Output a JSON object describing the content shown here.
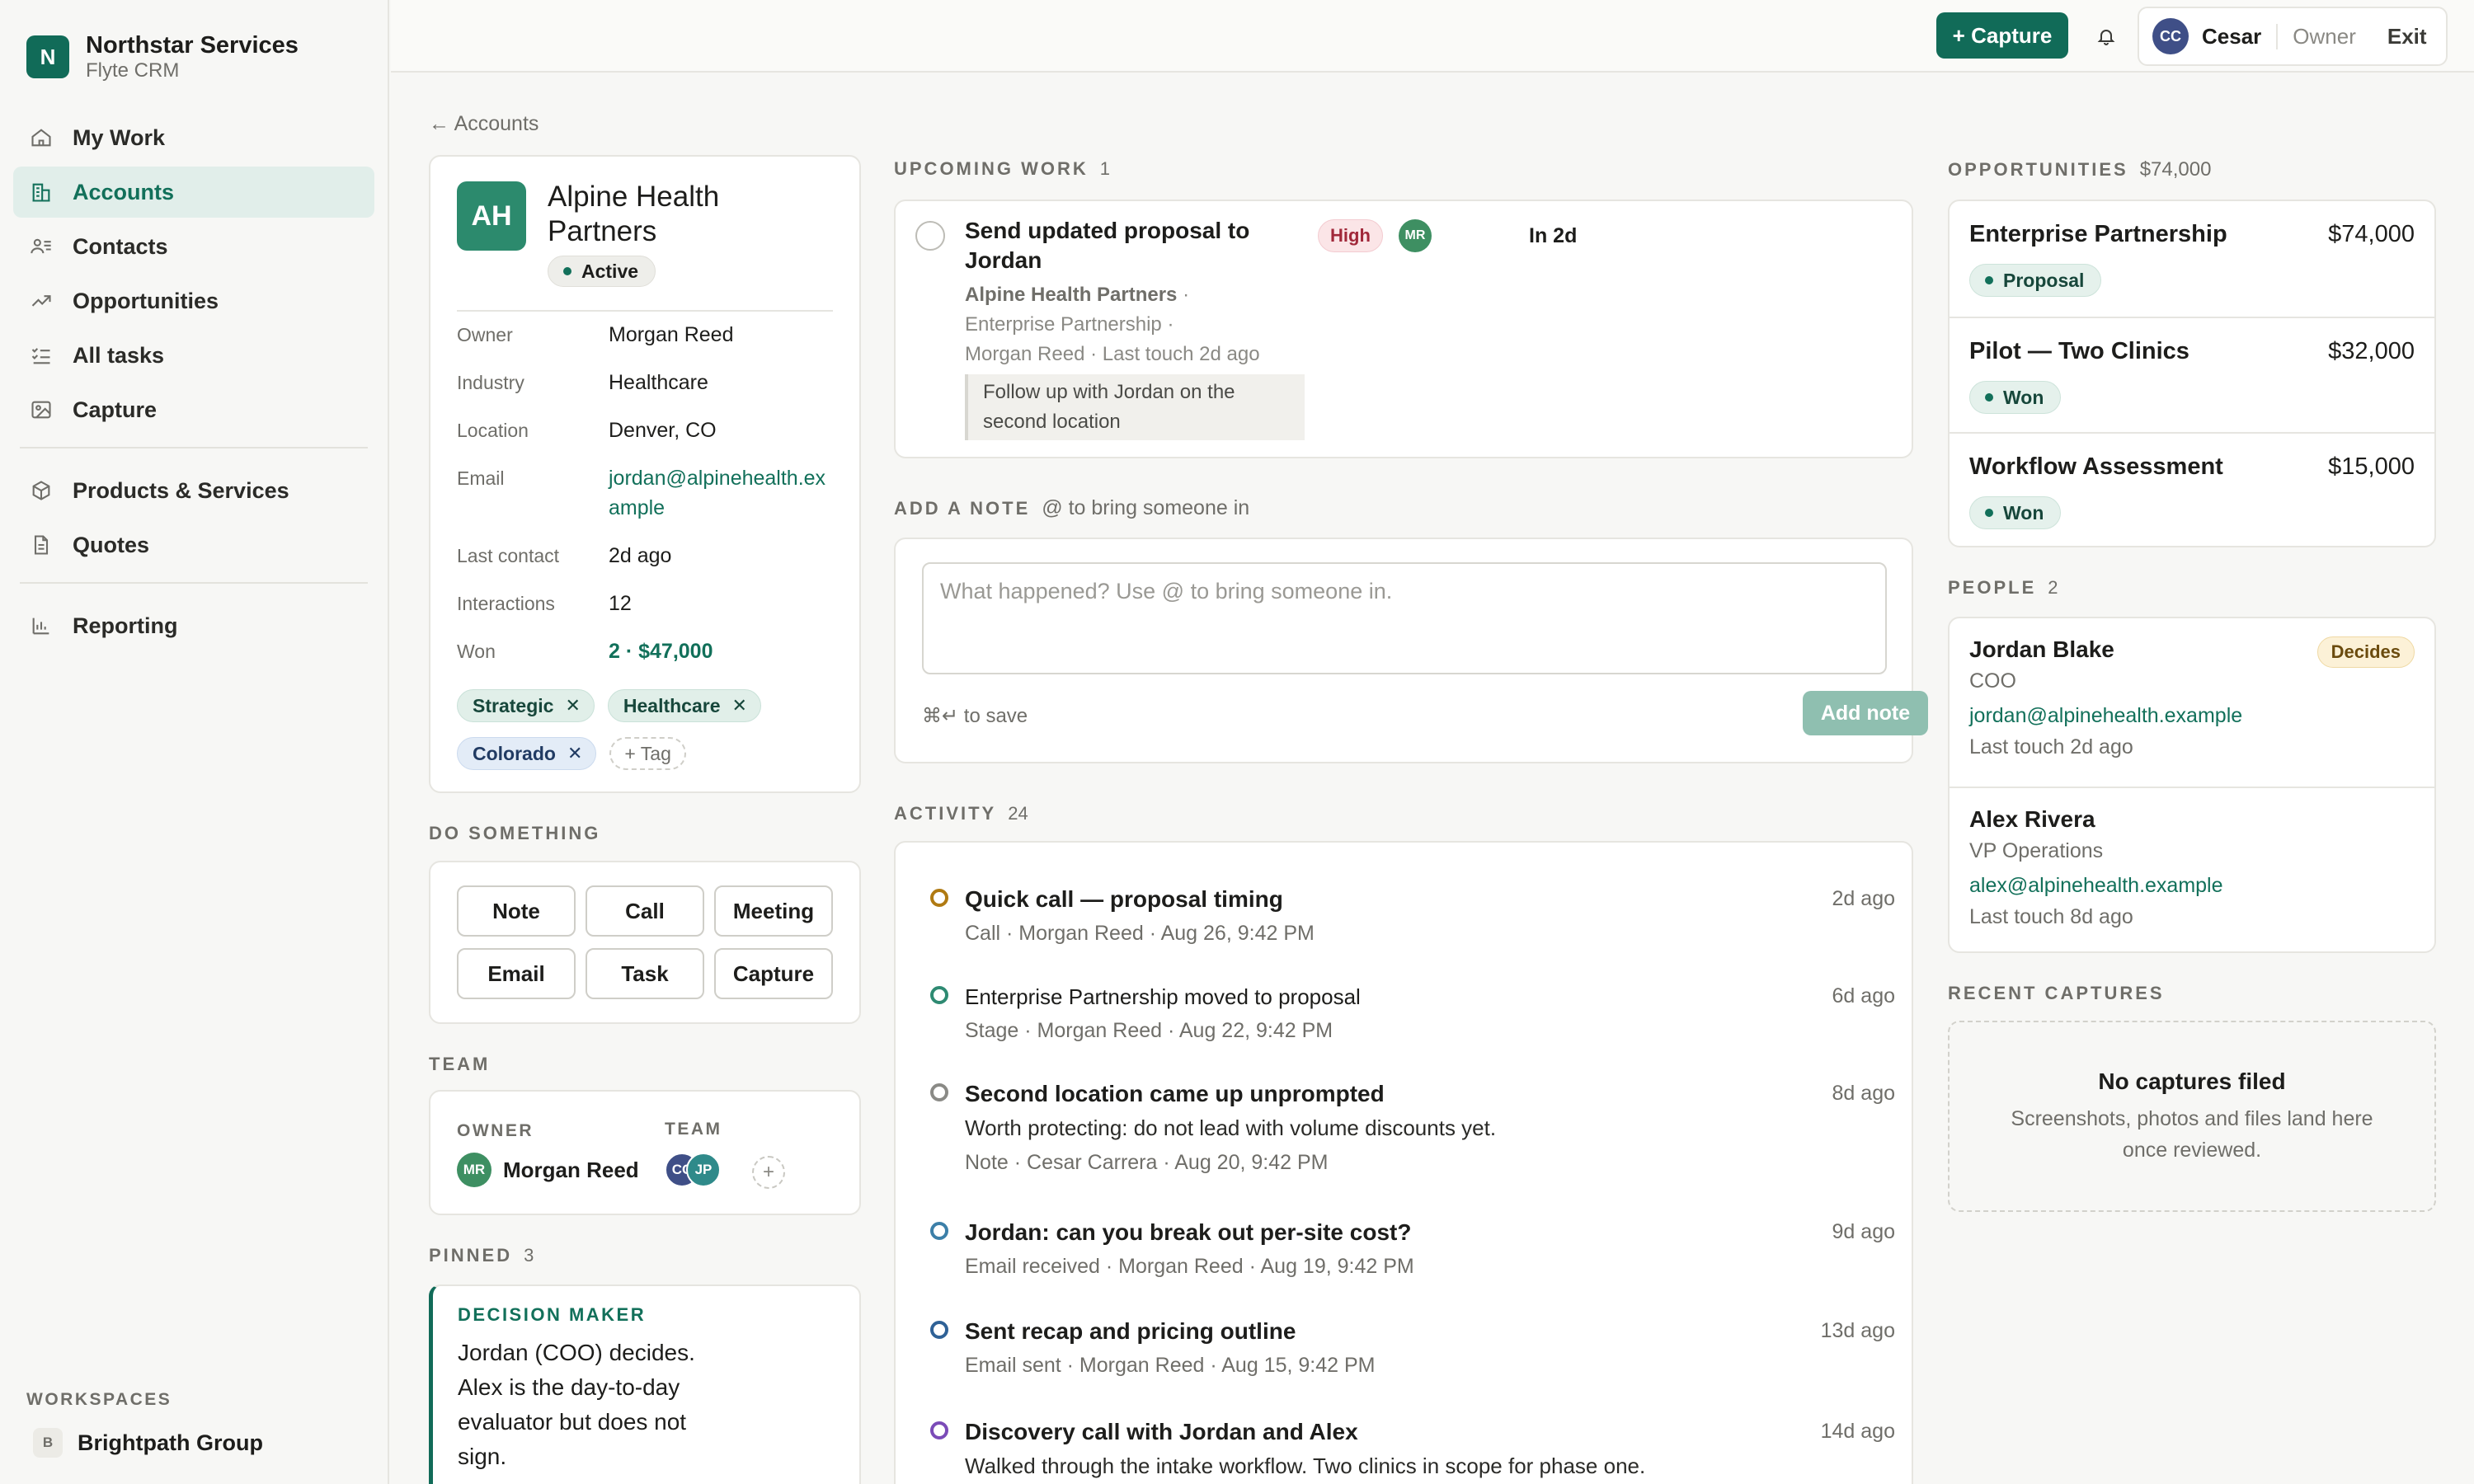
{
  "brand": {
    "name": "Northstar Services",
    "sub": "Flyte CRM",
    "mark": "N"
  },
  "nav": {
    "my_work": "My Work",
    "accounts": "Accounts",
    "contacts": "Contacts",
    "opportunities": "Opportunities",
    "all_tasks": "All tasks",
    "capture": "Capture",
    "products": "Products & Services",
    "quotes": "Quotes",
    "reporting": "Reporting"
  },
  "workspaces": {
    "label": "WORKSPACES",
    "badge": "B",
    "name": "Brightpath Group"
  },
  "topbar": {
    "capture_label": "+ Capture",
    "user_initials": "CC",
    "user_name": "Cesar",
    "user_role": "Owner",
    "exit_label": "Exit"
  },
  "breadcrumb": "← Accounts",
  "account": {
    "initials": "AH",
    "name": "Alpine Health Partners",
    "status": "Active",
    "fields": {
      "owner_k": "Owner",
      "owner_v": "Morgan Reed",
      "industry_k": "Industry",
      "industry_v": "Healthcare",
      "location_k": "Location",
      "location_v": "Denver, CO",
      "email_k": "Email",
      "email_v": "jordan@alpinehealth.example",
      "last_contact_k": "Last contact",
      "last_contact_v": "2d ago",
      "interactions_k": "Interactions",
      "interactions_v": "12",
      "won_k": "Won",
      "won_v": "2 · $47,000"
    },
    "tags": [
      "Strategic",
      "Healthcare",
      "Colorado"
    ],
    "add_tag": "+ Tag"
  },
  "do_something": {
    "label": "DO SOMETHING",
    "actions": [
      "Note",
      "Call",
      "Meeting",
      "Email",
      "Task",
      "Capture"
    ]
  },
  "team": {
    "label": "TEAM",
    "owner_label": "OWNER",
    "team_label": "TEAM",
    "owner_initials": "MR",
    "owner_name": "Morgan Reed",
    "members": [
      "CC",
      "JP"
    ],
    "add": "+"
  },
  "pinned": {
    "label": "PINNED",
    "count": "3",
    "title": "DECISION MAKER",
    "body": "Jordan (COO) decides. Alex is the day-to-day evaluator but does not sign."
  },
  "upcoming": {
    "label": "UPCOMING WORK",
    "count": "1",
    "task": {
      "title": "Send updated proposal to Jordan",
      "priority": "High",
      "assignee": "MR",
      "due": "In 2d",
      "account": "Alpine Health Partners",
      "opportunity": "Enterprise Partnership",
      "owner": "Morgan Reed",
      "last_touch": "Last touch 2d ago",
      "note": "Follow up with Jordan on the second location"
    }
  },
  "add_note": {
    "label": "ADD A NOTE",
    "hint": "@ to bring someone in",
    "placeholder": "What happened? Use @ to bring someone in.",
    "save_hint": "⌘↵ to save",
    "button": "Add note"
  },
  "activity": {
    "label": "ACTIVITY",
    "count": "24",
    "items": [
      {
        "title": "Quick call — proposal timing",
        "meta": "Call · Morgan Reed · Aug 26, 9:42 PM",
        "time": "2d ago",
        "color": "#b07a12"
      },
      {
        "title": "Enterprise Partnership moved to proposal",
        "meta": "Stage · Morgan Reed · Aug 22, 9:42 PM",
        "time": "6d ago",
        "color": "#2e8a72"
      },
      {
        "title": "Second location came up unprompted",
        "body": "Worth protecting: do not lead with volume discounts yet.",
        "meta": "Note · Cesar Carrera · Aug 20, 9:42 PM",
        "time": "8d ago",
        "color": "#8a8a86"
      },
      {
        "title": "Jordan: can you break out per-site cost?",
        "meta": "Email received · Morgan Reed · Aug 19, 9:42 PM",
        "time": "9d ago",
        "color": "#3c7fa8"
      },
      {
        "title": "Sent recap and pricing outline",
        "meta": "Email sent · Morgan Reed · Aug 15, 9:42 PM",
        "time": "13d ago",
        "color": "#2f6196"
      },
      {
        "title": "Discovery call with Jordan and Alex",
        "body": "Walked through the intake workflow. Two clinics in scope for phase one.",
        "time": "14d ago",
        "color": "#7b4bb8"
      }
    ]
  },
  "opportunities": {
    "label": "OPPORTUNITIES",
    "total": "$74,000",
    "items": [
      {
        "name": "Enterprise Partnership",
        "amount": "$74,000",
        "stage": "Proposal"
      },
      {
        "name": "Pilot — Two Clinics",
        "amount": "$32,000",
        "stage": "Won"
      },
      {
        "name": "Workflow Assessment",
        "amount": "$15,000",
        "stage": "Won"
      }
    ]
  },
  "people": {
    "label": "PEOPLE",
    "count": "2",
    "items": [
      {
        "name": "Jordan Blake",
        "role": "COO",
        "email": "jordan@alpinehealth.example",
        "touch": "Last touch 2d ago",
        "badge": "Decides"
      },
      {
        "name": "Alex Rivera",
        "role": "VP Operations",
        "email": "alex@alpinehealth.example",
        "touch": "Last touch 8d ago"
      }
    ]
  },
  "recent_captures": {
    "label": "RECENT CAPTURES",
    "title": "No captures filed",
    "sub": "Screenshots, photos and files land here once reviewed."
  },
  "colors": {
    "accent": "#116b58",
    "accent_soft": "#e1eeea",
    "high": "#a1283a"
  }
}
